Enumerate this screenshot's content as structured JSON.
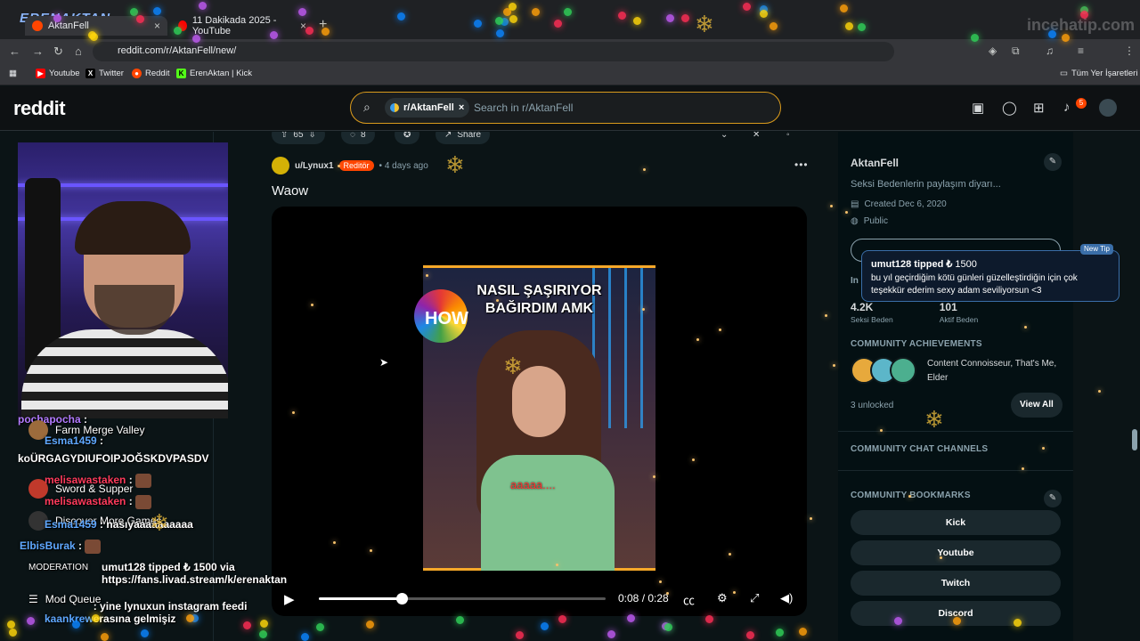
{
  "browser": {
    "channel_logo": "ERENAKTAN",
    "tabs": [
      {
        "title": "AktanFell",
        "close": "×"
      },
      {
        "title": "11 Dakikada 2025 - YouTube",
        "close": "×"
      }
    ],
    "new_tab": "+",
    "url": "reddit.com/r/AktanFell/new/",
    "watermark": "incehatip.com",
    "bookmarks": [
      {
        "label": "Youtube",
        "icon": "▶",
        "color": "#ff0000"
      },
      {
        "label": "Twitter",
        "icon": "X",
        "color": "#000000"
      },
      {
        "label": "Reddit",
        "icon": "●",
        "color": "#ff4500"
      },
      {
        "label": "ErenAktan | Kick",
        "icon": "K",
        "color": "#53fc18"
      }
    ],
    "bookmarks_folder": "Tüm Yer İşaretleri"
  },
  "reddit": {
    "logo": "reddit",
    "search": {
      "chip_label": "r/AktanFell",
      "chip_close": "×",
      "placeholder": "Search in r/AktanFell"
    },
    "notification_count": "5"
  },
  "post": {
    "votes": "65",
    "comments": "8",
    "share": "Share",
    "author": "u/Lynux1",
    "flair": "Reditör",
    "time": "• 4 days ago",
    "more": "•••",
    "title": "Waow",
    "video": {
      "caption": "NASIL ŞAŞIRIYOR\nBAĞIRDIM AMK",
      "logo_text": "HOW",
      "subtitle": "aaaaa....",
      "time": "0:08 / 0:28",
      "progress": 0.29
    }
  },
  "sidebar": {
    "name": "AktanFell",
    "description": "Seksi Bedenlerin paylaşım diyarı...",
    "created": "Created Dec 6, 2020",
    "visibility": "Public",
    "insights_label": "In",
    "stats": [
      {
        "value": "4.2K",
        "label": "Seksi Beden"
      },
      {
        "value": "101",
        "label": "Aktif Beden"
      }
    ],
    "achievements_heading": "COMMUNITY ACHIEVEMENTS",
    "achievements_text": "Content Connoisseur, That's Me, Elder",
    "unlocked": "3 unlocked",
    "view_all": "View All",
    "chat_heading": "COMMUNITY CHAT CHANNELS",
    "bookmarks_heading": "COMMUNITY BOOKMARKS",
    "bookmark_buttons": [
      "Kick",
      "Youtube",
      "Twitch",
      "Discord"
    ]
  },
  "tip": {
    "badge": "New Tip",
    "user": "umut128 tipped ₺",
    "amount": "1500",
    "message": "bu yıl geçirdiğim kötü günleri güzelleştirdiğin için çok teşekkür ederim sexy adam seviliyorsun <3"
  },
  "chat": {
    "messages": [
      {
        "user": "pochapocha",
        "text": " :"
      },
      {
        "user": "Esma1459",
        "text": " :"
      },
      {
        "user": "ko",
        "text": "ÜRGAGYDIUFOIPJOĞSKDVPASDV"
      },
      {
        "user": "melisawastaken",
        "text": " :"
      },
      {
        "user": "melisawastaken",
        "text": " :"
      },
      {
        "user": "Esma1459",
        "text": " : nasıyaaaaaaaaaa"
      },
      {
        "user": "ElbisBurak",
        "text": " :"
      },
      {
        "user": "",
        "text": "umut128 tipped ₺ 1500 via https://fans.livad.stream/k/erenaktan"
      },
      {
        "user": "kaankrew",
        "text": " : yine lynuxun instagram feedi erasına gelmişiz"
      }
    ],
    "game_menu": [
      "Farm Merge Valley",
      "Sword & Supper",
      "Discover More Games",
      "MODERATION",
      "Mod Queue"
    ]
  }
}
